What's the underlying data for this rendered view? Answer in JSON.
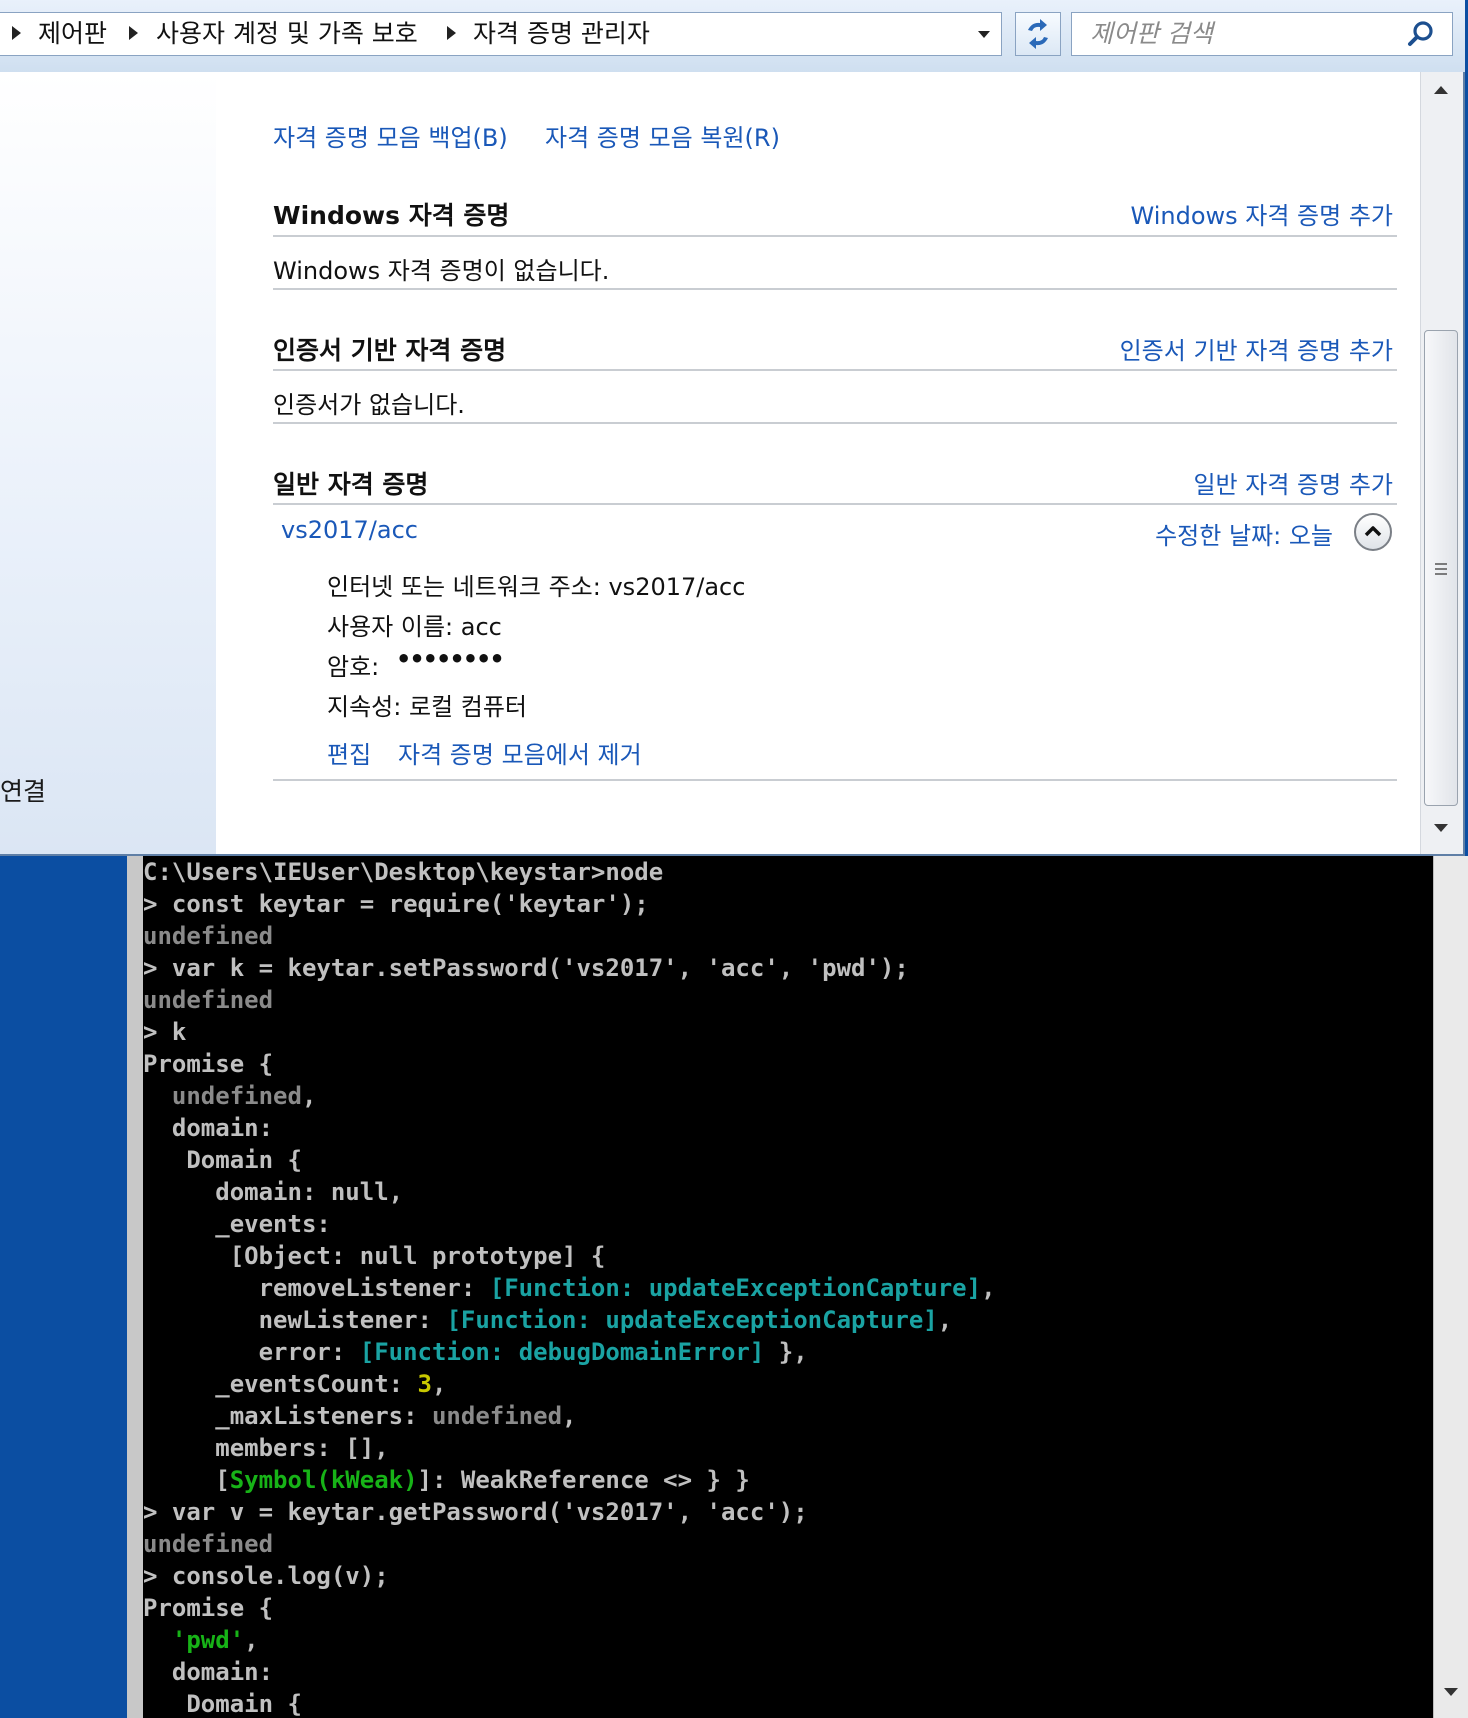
{
  "address_bar": {
    "breadcrumb": [
      "제어판",
      "사용자 계정 및 가족 보호",
      "자격 증명 관리자"
    ],
    "search_placeholder": "제어판 검색"
  },
  "left_pane": {
    "partial_item": "연결"
  },
  "credential_manager": {
    "backup_link": "자격 증명 모음 백업(B)",
    "restore_link": "자격 증명 모음 복원(R)",
    "sections": [
      {
        "title": "Windows 자격 증명",
        "add_link": "Windows 자격 증명 추가",
        "empty_text": "Windows 자격 증명이 없습니다."
      },
      {
        "title": "인증서 기반 자격 증명",
        "add_link": "인증서 기반 자격 증명 추가",
        "empty_text": "인증서가 없습니다."
      },
      {
        "title": "일반 자격 증명",
        "add_link": "일반 자격 증명 추가"
      }
    ],
    "credential": {
      "name": "vs2017/acc",
      "modified": "수정한 날짜:  오늘",
      "address": "인터넷 또는 네트워크 주소:  vs2017/acc",
      "username": "사용자 이름:  acc",
      "password_label": "암호:",
      "password_mask": "••••••••",
      "persistence": "지속성:  로컬 컴퓨터",
      "edit_link": "편집",
      "remove_link": "자격 증명 모음에서 제거"
    }
  },
  "console": {
    "colors": {
      "default": "#c0c0c0",
      "white": "#ffffff",
      "gray": "#8a8a8a",
      "cyan": "#1aa3a3",
      "yellow": "#c8c800",
      "green": "#17b317"
    },
    "lines": [
      [
        {
          "t": "C:\\Users\\IEUser\\Desktop\\keystar>node",
          "c": "default"
        }
      ],
      [
        {
          "t": "> const keytar = require('keytar');",
          "c": "default"
        }
      ],
      [
        {
          "t": "undefined",
          "c": "gray"
        }
      ],
      [
        {
          "t": "> var k = keytar.setPassword('vs2017', 'acc', 'pwd');",
          "c": "default"
        }
      ],
      [
        {
          "t": "undefined",
          "c": "gray"
        }
      ],
      [
        {
          "t": "> k",
          "c": "default"
        }
      ],
      [
        {
          "t": "Promise {",
          "c": "default"
        }
      ],
      [
        {
          "t": "  ",
          "c": "default"
        },
        {
          "t": "undefined",
          "c": "gray"
        },
        {
          "t": ",",
          "c": "default"
        }
      ],
      [
        {
          "t": "  domain:",
          "c": "default"
        }
      ],
      [
        {
          "t": "   Domain {",
          "c": "default"
        }
      ],
      [
        {
          "t": "     domain: null,",
          "c": "default"
        }
      ],
      [
        {
          "t": "     _events:",
          "c": "default"
        }
      ],
      [
        {
          "t": "      [Object: null prototype] {",
          "c": "default"
        }
      ],
      [
        {
          "t": "        removeListener: ",
          "c": "default"
        },
        {
          "t": "[Function: updateExceptionCapture]",
          "c": "cyan"
        },
        {
          "t": ",",
          "c": "default"
        }
      ],
      [
        {
          "t": "        newListener: ",
          "c": "default"
        },
        {
          "t": "[Function: updateExceptionCapture]",
          "c": "cyan"
        },
        {
          "t": ",",
          "c": "default"
        }
      ],
      [
        {
          "t": "        error: ",
          "c": "default"
        },
        {
          "t": "[Function: debugDomainError]",
          "c": "cyan"
        },
        {
          "t": " },",
          "c": "default"
        }
      ],
      [
        {
          "t": "     _eventsCount: ",
          "c": "default"
        },
        {
          "t": "3",
          "c": "yellow"
        },
        {
          "t": ",",
          "c": "default"
        }
      ],
      [
        {
          "t": "     _maxListeners: ",
          "c": "default"
        },
        {
          "t": "undefined",
          "c": "gray"
        },
        {
          "t": ",",
          "c": "default"
        }
      ],
      [
        {
          "t": "     members: [],",
          "c": "default"
        }
      ],
      [
        {
          "t": "     [",
          "c": "default"
        },
        {
          "t": "Symbol(kWeak)",
          "c": "green"
        },
        {
          "t": "]: WeakReference <> } }",
          "c": "default"
        }
      ],
      [
        {
          "t": "> var v = keytar.getPassword('vs2017', 'acc');",
          "c": "default"
        }
      ],
      [
        {
          "t": "undefined",
          "c": "gray"
        }
      ],
      [
        {
          "t": "> console.log(v);",
          "c": "default"
        }
      ],
      [
        {
          "t": "Promise {",
          "c": "default"
        }
      ],
      [
        {
          "t": "  ",
          "c": "default"
        },
        {
          "t": "'pwd'",
          "c": "green"
        },
        {
          "t": ",",
          "c": "default"
        }
      ],
      [
        {
          "t": "  domain:",
          "c": "default"
        }
      ],
      [
        {
          "t": "   Domain {",
          "c": "default"
        }
      ]
    ]
  }
}
